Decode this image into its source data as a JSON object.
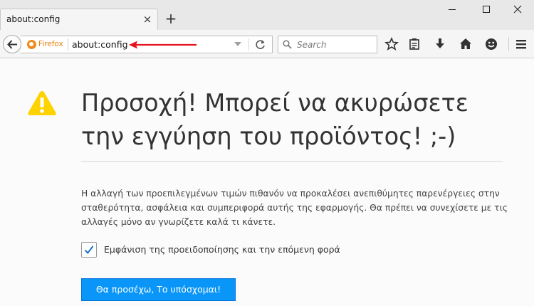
{
  "tab": {
    "title": "about:config",
    "close_glyph": "×"
  },
  "new_tab_glyph": "+",
  "navbar": {
    "identity_label": "Firefox",
    "url": "about:config",
    "search_placeholder": "Search"
  },
  "icons": [
    "back-arrow-icon",
    "firefox-icon",
    "dropdown-arrow-icon",
    "reload-icon",
    "search-icon",
    "bookmark-star-icon",
    "reading-list-icon",
    "download-icon",
    "home-icon",
    "hello-icon",
    "menu-icon",
    "warning-icon",
    "checkmark-icon"
  ],
  "content": {
    "title": "Προσοχή! Μπορεί να ακυρώσετε την εγγύηση του προϊόντος! ;-)",
    "description": "Η αλλαγή των προεπιλεγμένων τιμών πιθανόν να προκαλέσει ανεπιθύμητες παρενέργειες στην σταθερότητα, ασφάλεια και συμπεριφορά αυτής της εφαρμογής. Θα πρέπει να συνεχίσετε με τις αλλαγές μόνο αν γνωρίζετε καλά τι κάνετε.",
    "checkbox_label": "Εμφάνιση της προειδοποίησης και την επόμενη φορά",
    "checkbox_checked": true,
    "accept_button": "Θα προσέχω, Το υπόσχομαι!"
  },
  "colors": {
    "accent": "#0996f8",
    "warning": "#ffd300",
    "annotation": "#e8121c",
    "firefox": "#e8820c"
  }
}
